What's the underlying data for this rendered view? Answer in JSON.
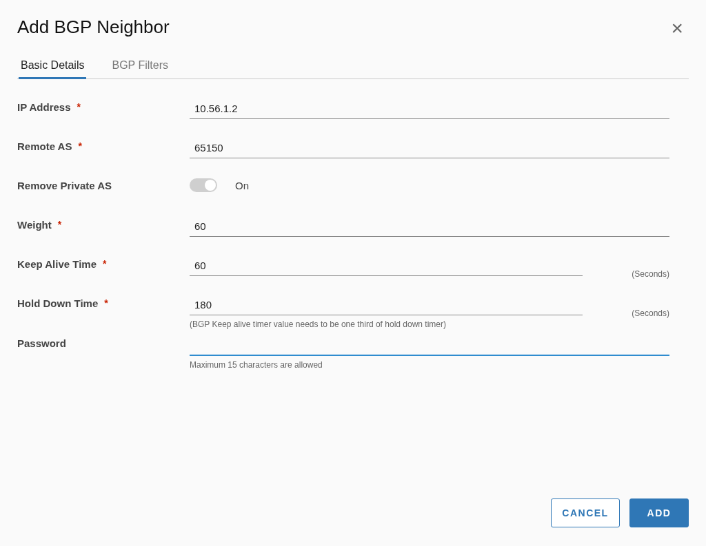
{
  "dialog": {
    "title": "Add BGP Neighbor",
    "close_icon": "×"
  },
  "tabs": [
    {
      "label": "Basic Details",
      "selected": true
    },
    {
      "label": "BGP Filters",
      "selected": false
    }
  ],
  "fields": [
    {
      "kind": "text",
      "label": "IP Address",
      "required_mark": "*",
      "value": "10.56.1.2",
      "focused": false
    },
    {
      "kind": "text",
      "label": "Remote AS",
      "required_mark": "*",
      "value": "65150",
      "focused": false
    },
    {
      "kind": "toggle",
      "label": "Remove Private AS",
      "on": true,
      "state_label": "On"
    },
    {
      "kind": "text",
      "label": "Weight",
      "required_mark": "*",
      "value": "60",
      "focused": false
    },
    {
      "kind": "text",
      "label": "Keep Alive Time",
      "required_mark": "*",
      "value": "60",
      "unit": "(Seconds)",
      "focused": false
    },
    {
      "kind": "text",
      "label": "Hold Down Time",
      "required_mark": "*",
      "value": "180",
      "unit": "(Seconds)",
      "hint": "(BGP Keep alive timer value needs to be one third of hold down timer)",
      "focused": false
    },
    {
      "kind": "password",
      "label": "Password",
      "hint": "Maximum 15 characters are allowed",
      "focused": true
    }
  ],
  "buttons": [
    {
      "label": "CANCEL",
      "kind": "secondary"
    },
    {
      "label": "ADD",
      "kind": "primary"
    }
  ]
}
